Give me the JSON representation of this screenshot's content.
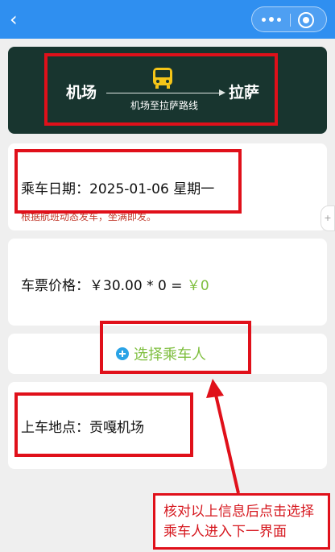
{
  "route": {
    "from": "机场",
    "to": "拉萨",
    "subtitle": "机场至拉萨路线"
  },
  "date": {
    "label": "乘车日期：2025-01-06 星期一",
    "note": "根据航班动态发车，坐满即发。"
  },
  "price": {
    "label": "车票价格：￥30.00 * 0 = ",
    "total": "￥0"
  },
  "select_passenger": {
    "label": "选择乘车人"
  },
  "boarding": {
    "label": "上车地点：贡嘎机场"
  },
  "side_tab": {
    "label": "+"
  },
  "annotation": {
    "note_line1": "核对以上信息后点击选择",
    "note_line2": "乘车人进入下一界面"
  },
  "colors": {
    "topbar": "#2f8ff0",
    "route_card": "#18352f",
    "bus_icon": "#f5c518",
    "accent_green": "#7fbf3f",
    "note_red": "#e0101a"
  },
  "icons": {
    "back": "chevron-left-icon",
    "more": "more-dots-icon",
    "close": "target-icon",
    "bus": "bus-icon",
    "add": "plus-circle-icon"
  }
}
